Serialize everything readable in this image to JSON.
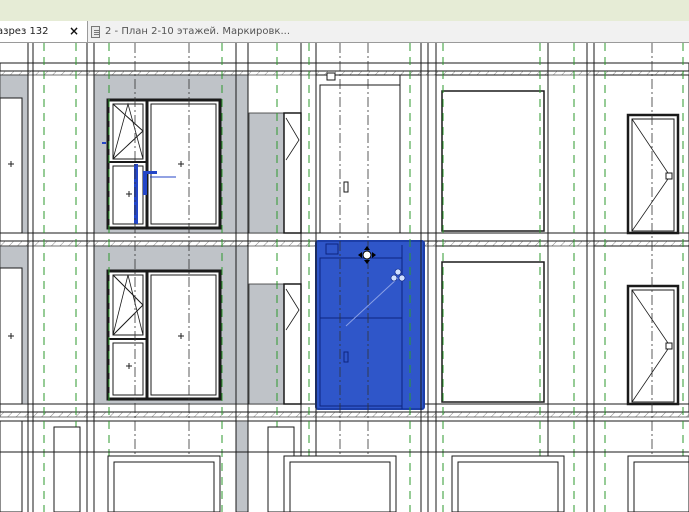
{
  "tabs": [
    {
      "label": "азрез 132",
      "close_icon": "×",
      "active": true
    },
    {
      "label": "2 - План 2-10 этажей. Маркировк...",
      "active": false
    }
  ],
  "colors": {
    "selection": "#2f56c9",
    "selection_edge": "#1c3ea8",
    "wall_fill": "#bfc3c8",
    "line": "#1a1a1a",
    "grid_dash": "#2e9a2e",
    "tab_bar": "#f1f1f1",
    "top_strip": "#e6ecd6"
  },
  "icons": {
    "tab_view_icon": "view-icon",
    "cursor": "move-cursor-icon",
    "selection_grip": "drag-grip-icon"
  }
}
